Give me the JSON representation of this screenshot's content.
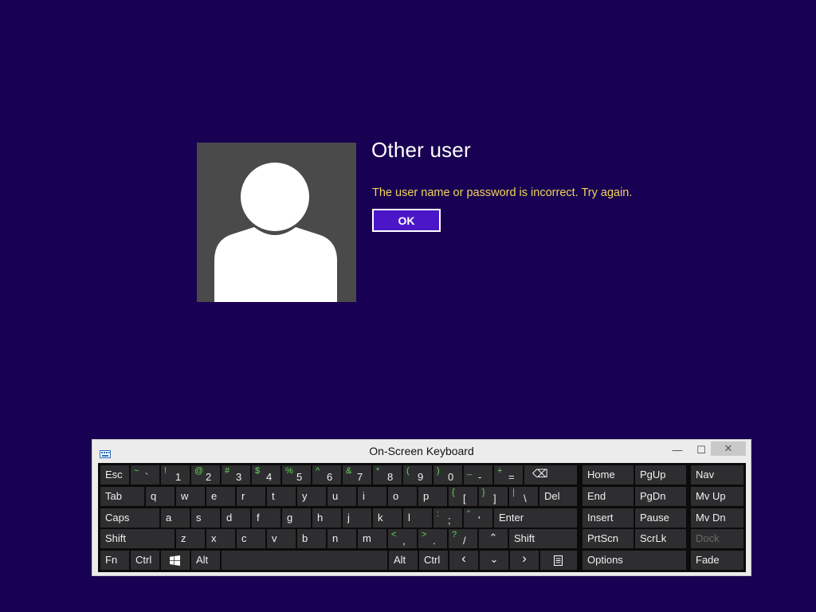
{
  "login": {
    "user_title": "Other user",
    "error_message": "The user name or password is incorrect. Try again.",
    "ok_label": "OK"
  },
  "osk": {
    "title": "On-Screen Keyboard",
    "min_glyph": "—",
    "max_glyph": "☐",
    "close_glyph": "✕",
    "keys": {
      "esc": "Esc",
      "tilde_shift": "~",
      "tilde": "`",
      "k1_shift": "!",
      "k1": "1",
      "k2_shift": "@",
      "k2": "2",
      "k3_shift": "#",
      "k3": "3",
      "k4_shift": "$",
      "k4": "4",
      "k5_shift": "%",
      "k5": "5",
      "k6_shift": "^",
      "k6": "6",
      "k7_shift": "&",
      "k7": "7",
      "k8_shift": "*",
      "k8": "8",
      "k9_shift": "(",
      "k9": "9",
      "k0_shift": ")",
      "k0": "0",
      "minus_shift": "_",
      "minus": "-",
      "equals_shift": "+",
      "equals": "=",
      "backspace": "⌫",
      "home": "Home",
      "pgup": "PgUp",
      "nav": "Nav",
      "tab": "Tab",
      "q": "q",
      "w": "w",
      "e": "e",
      "r": "r",
      "t": "t",
      "y": "y",
      "u": "u",
      "i": "i",
      "o": "o",
      "p": "p",
      "lbracket_shift": "{",
      "lbracket": "[",
      "rbracket_shift": "}",
      "rbracket": "]",
      "backslash_shift": "|",
      "backslash": "\\",
      "del": "Del",
      "end": "End",
      "pgdn": "PgDn",
      "mvup": "Mv Up",
      "caps": "Caps",
      "a": "a",
      "s": "s",
      "d": "d",
      "f": "f",
      "g": "g",
      "h": "h",
      "j": "j",
      "k": "k",
      "l": "l",
      "semicolon_shift": ":",
      "semicolon": ";",
      "quote_shift": "\"",
      "quote": "'",
      "enter": "Enter",
      "insert": "Insert",
      "pause": "Pause",
      "mvdn": "Mv Dn",
      "shift_left": "Shift",
      "z": "z",
      "x": "x",
      "c": "c",
      "v": "v",
      "b": "b",
      "n": "n",
      "m": "m",
      "comma_shift": "<",
      "comma": ",",
      "period_shift": ">",
      "period": ".",
      "slash_shift": "?",
      "slash": "/",
      "up": "⌃",
      "shift_right": "Shift",
      "prtscn": "PrtScn",
      "scrlk": "ScrLk",
      "dock": "Dock",
      "fn": "Fn",
      "ctrl_left": "Ctrl",
      "alt_left": "Alt",
      "alt_right": "Alt",
      "ctrl_right": "Ctrl",
      "left": "‹",
      "down": "⌄",
      "right": "›",
      "options": "Options",
      "fade": "Fade"
    }
  }
}
